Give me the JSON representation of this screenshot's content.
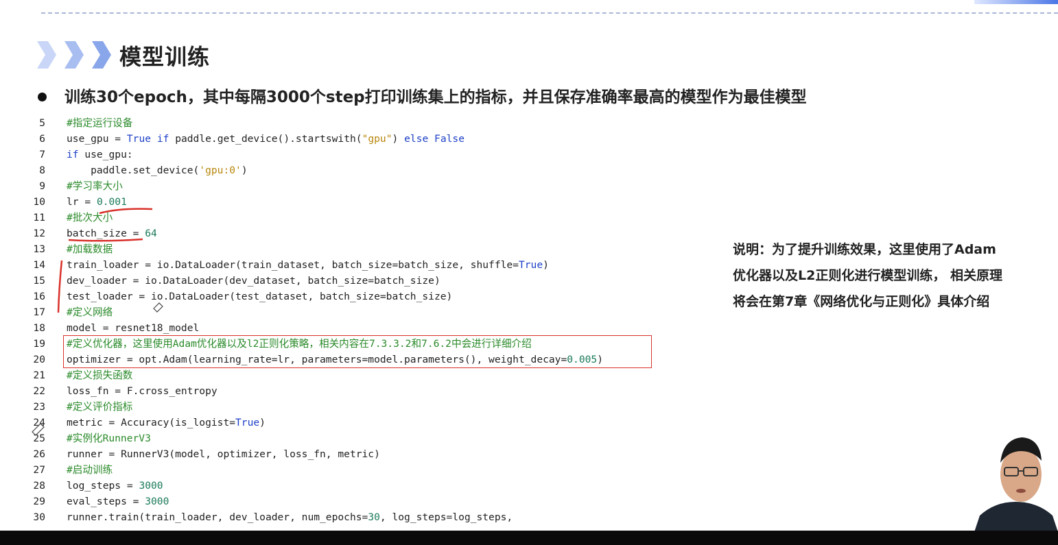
{
  "slide": {
    "title": "模型训练",
    "bullet": "训练30个epoch，其中每隔3000个step打印训练集上的指标，并且保存准确率最高的模型作为最佳模型"
  },
  "code": [
    {
      "n": "5",
      "parts": [
        [
          "cm",
          "#指定运行设备"
        ]
      ]
    },
    {
      "n": "6",
      "parts": [
        [
          "",
          "use_gpu = "
        ],
        [
          "kw",
          "True"
        ],
        [
          "",
          " "
        ],
        [
          "kw",
          "if"
        ],
        [
          "",
          " paddle.get_device().startswith("
        ],
        [
          "str",
          "\"gpu\""
        ],
        [
          "",
          ") "
        ],
        [
          "kw",
          "else"
        ],
        [
          "",
          " "
        ],
        [
          "kw",
          "False"
        ]
      ]
    },
    {
      "n": "7",
      "parts": [
        [
          "kw",
          "if"
        ],
        [
          "",
          " use_gpu:"
        ]
      ]
    },
    {
      "n": "8",
      "parts": [
        [
          "",
          "    paddle.set_device("
        ],
        [
          "str",
          "'gpu:0'"
        ],
        [
          "",
          ")"
        ]
      ]
    },
    {
      "n": "9",
      "parts": [
        [
          "cm",
          "#学习率大小"
        ]
      ]
    },
    {
      "n": "10",
      "parts": [
        [
          "",
          "lr = "
        ],
        [
          "num",
          "0.001"
        ]
      ]
    },
    {
      "n": "11",
      "parts": [
        [
          "cm",
          "#批次大小"
        ]
      ]
    },
    {
      "n": "12",
      "parts": [
        [
          "",
          "batch_size = "
        ],
        [
          "num",
          "64"
        ]
      ]
    },
    {
      "n": "13",
      "parts": [
        [
          "cm",
          "#加载数据"
        ]
      ]
    },
    {
      "n": "14",
      "parts": [
        [
          "",
          "train_loader = io.DataLoader(train_dataset, batch_size=batch_size, shuffle="
        ],
        [
          "kw",
          "True"
        ],
        [
          "",
          ")"
        ]
      ]
    },
    {
      "n": "15",
      "parts": [
        [
          "",
          "dev_loader = io.DataLoader(dev_dataset, batch_size=batch_size)"
        ]
      ]
    },
    {
      "n": "16",
      "parts": [
        [
          "",
          "test_loader = io.DataLoader(test_dataset, batch_size=batch_size)"
        ]
      ]
    },
    {
      "n": "17",
      "parts": [
        [
          "cm",
          "#定义网络"
        ]
      ]
    },
    {
      "n": "18",
      "parts": [
        [
          "",
          "model = resnet18_model"
        ]
      ]
    },
    {
      "n": "19",
      "parts": [
        [
          "cm",
          "#定义优化器，这里使用Adam优化器以及l2正则化策略，相关内容在7.3.3.2和7.6.2中会进行详细介绍"
        ]
      ]
    },
    {
      "n": "20",
      "parts": [
        [
          "",
          "optimizer = opt.Adam(learning_rate=lr, parameters=model.parameters(), weight_decay="
        ],
        [
          "num",
          "0.005"
        ],
        [
          "",
          ")"
        ]
      ]
    },
    {
      "n": "21",
      "parts": [
        [
          "cm",
          "#定义损失函数"
        ]
      ]
    },
    {
      "n": "22",
      "parts": [
        [
          "",
          "loss_fn = F.cross_entropy"
        ]
      ]
    },
    {
      "n": "23",
      "parts": [
        [
          "cm",
          "#定义评价指标"
        ]
      ]
    },
    {
      "n": "24",
      "parts": [
        [
          "",
          "metric = Accuracy(is_logist="
        ],
        [
          "kw",
          "True"
        ],
        [
          "",
          ")"
        ]
      ]
    },
    {
      "n": "25",
      "parts": [
        [
          "cm",
          "#实例化RunnerV3"
        ]
      ]
    },
    {
      "n": "26",
      "parts": [
        [
          "",
          "runner = RunnerV3(model, optimizer, loss_fn, metric)"
        ]
      ]
    },
    {
      "n": "27",
      "parts": [
        [
          "cm",
          "#启动训练"
        ]
      ]
    },
    {
      "n": "28",
      "parts": [
        [
          "",
          "log_steps = "
        ],
        [
          "num",
          "3000"
        ]
      ]
    },
    {
      "n": "29",
      "parts": [
        [
          "",
          "eval_steps = "
        ],
        [
          "num",
          "3000"
        ]
      ]
    },
    {
      "n": "30",
      "parts": [
        [
          "",
          "runner.train(train_loader, dev_loader, num_epochs="
        ],
        [
          "num",
          "30"
        ],
        [
          "",
          ", log_steps=log_steps,"
        ]
      ]
    }
  ],
  "note": {
    "lines": [
      "说明：为了提升训练效果，这里使用了Adam",
      "优化器以及L2正则化进行模型训练， 相关原理",
      "将会在第7章《网络优化与正则化》具体介绍"
    ]
  },
  "colors": {
    "keyword": "#1e40c8",
    "string": "#b8860b",
    "number": "#1a7a5a",
    "comment": "#2a8a2a",
    "annotation": "#d9312b",
    "accent": "#2f7fe6"
  }
}
